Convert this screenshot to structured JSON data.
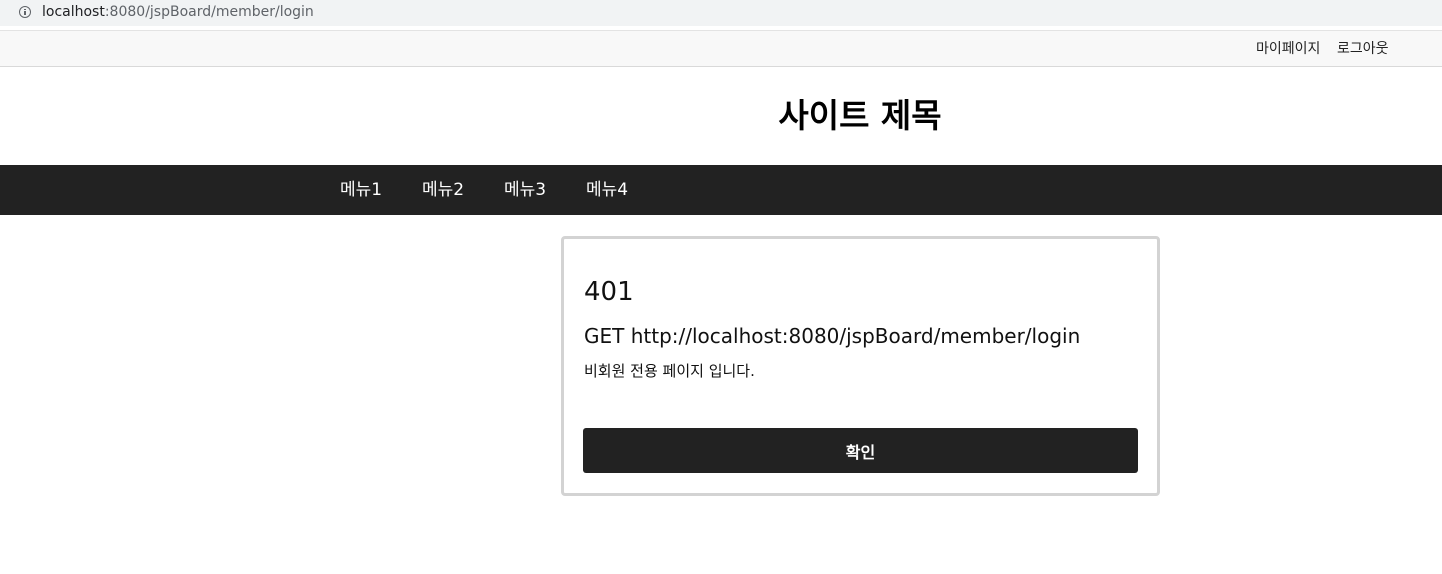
{
  "browser": {
    "url_host": "localhost",
    "url_rest": ":8080/jspBoard/member/login",
    "icon": "info-icon"
  },
  "topbar": {
    "mypage_label": "마이페이지",
    "logout_label": "로그아웃"
  },
  "header": {
    "title": "사이트 제목"
  },
  "nav": {
    "items": [
      {
        "label": "메뉴1"
      },
      {
        "label": "메뉴2"
      },
      {
        "label": "메뉴3"
      },
      {
        "label": "메뉴4"
      }
    ]
  },
  "error": {
    "code": "401",
    "request": "GET http://localhost:8080/jspBoard/member/login",
    "message": "비회원 전용 페이지 입니다.",
    "confirm_label": "확인"
  },
  "colors": {
    "nav_background": "#222222",
    "button_background": "#222222",
    "card_border": "#d3d3d3"
  }
}
